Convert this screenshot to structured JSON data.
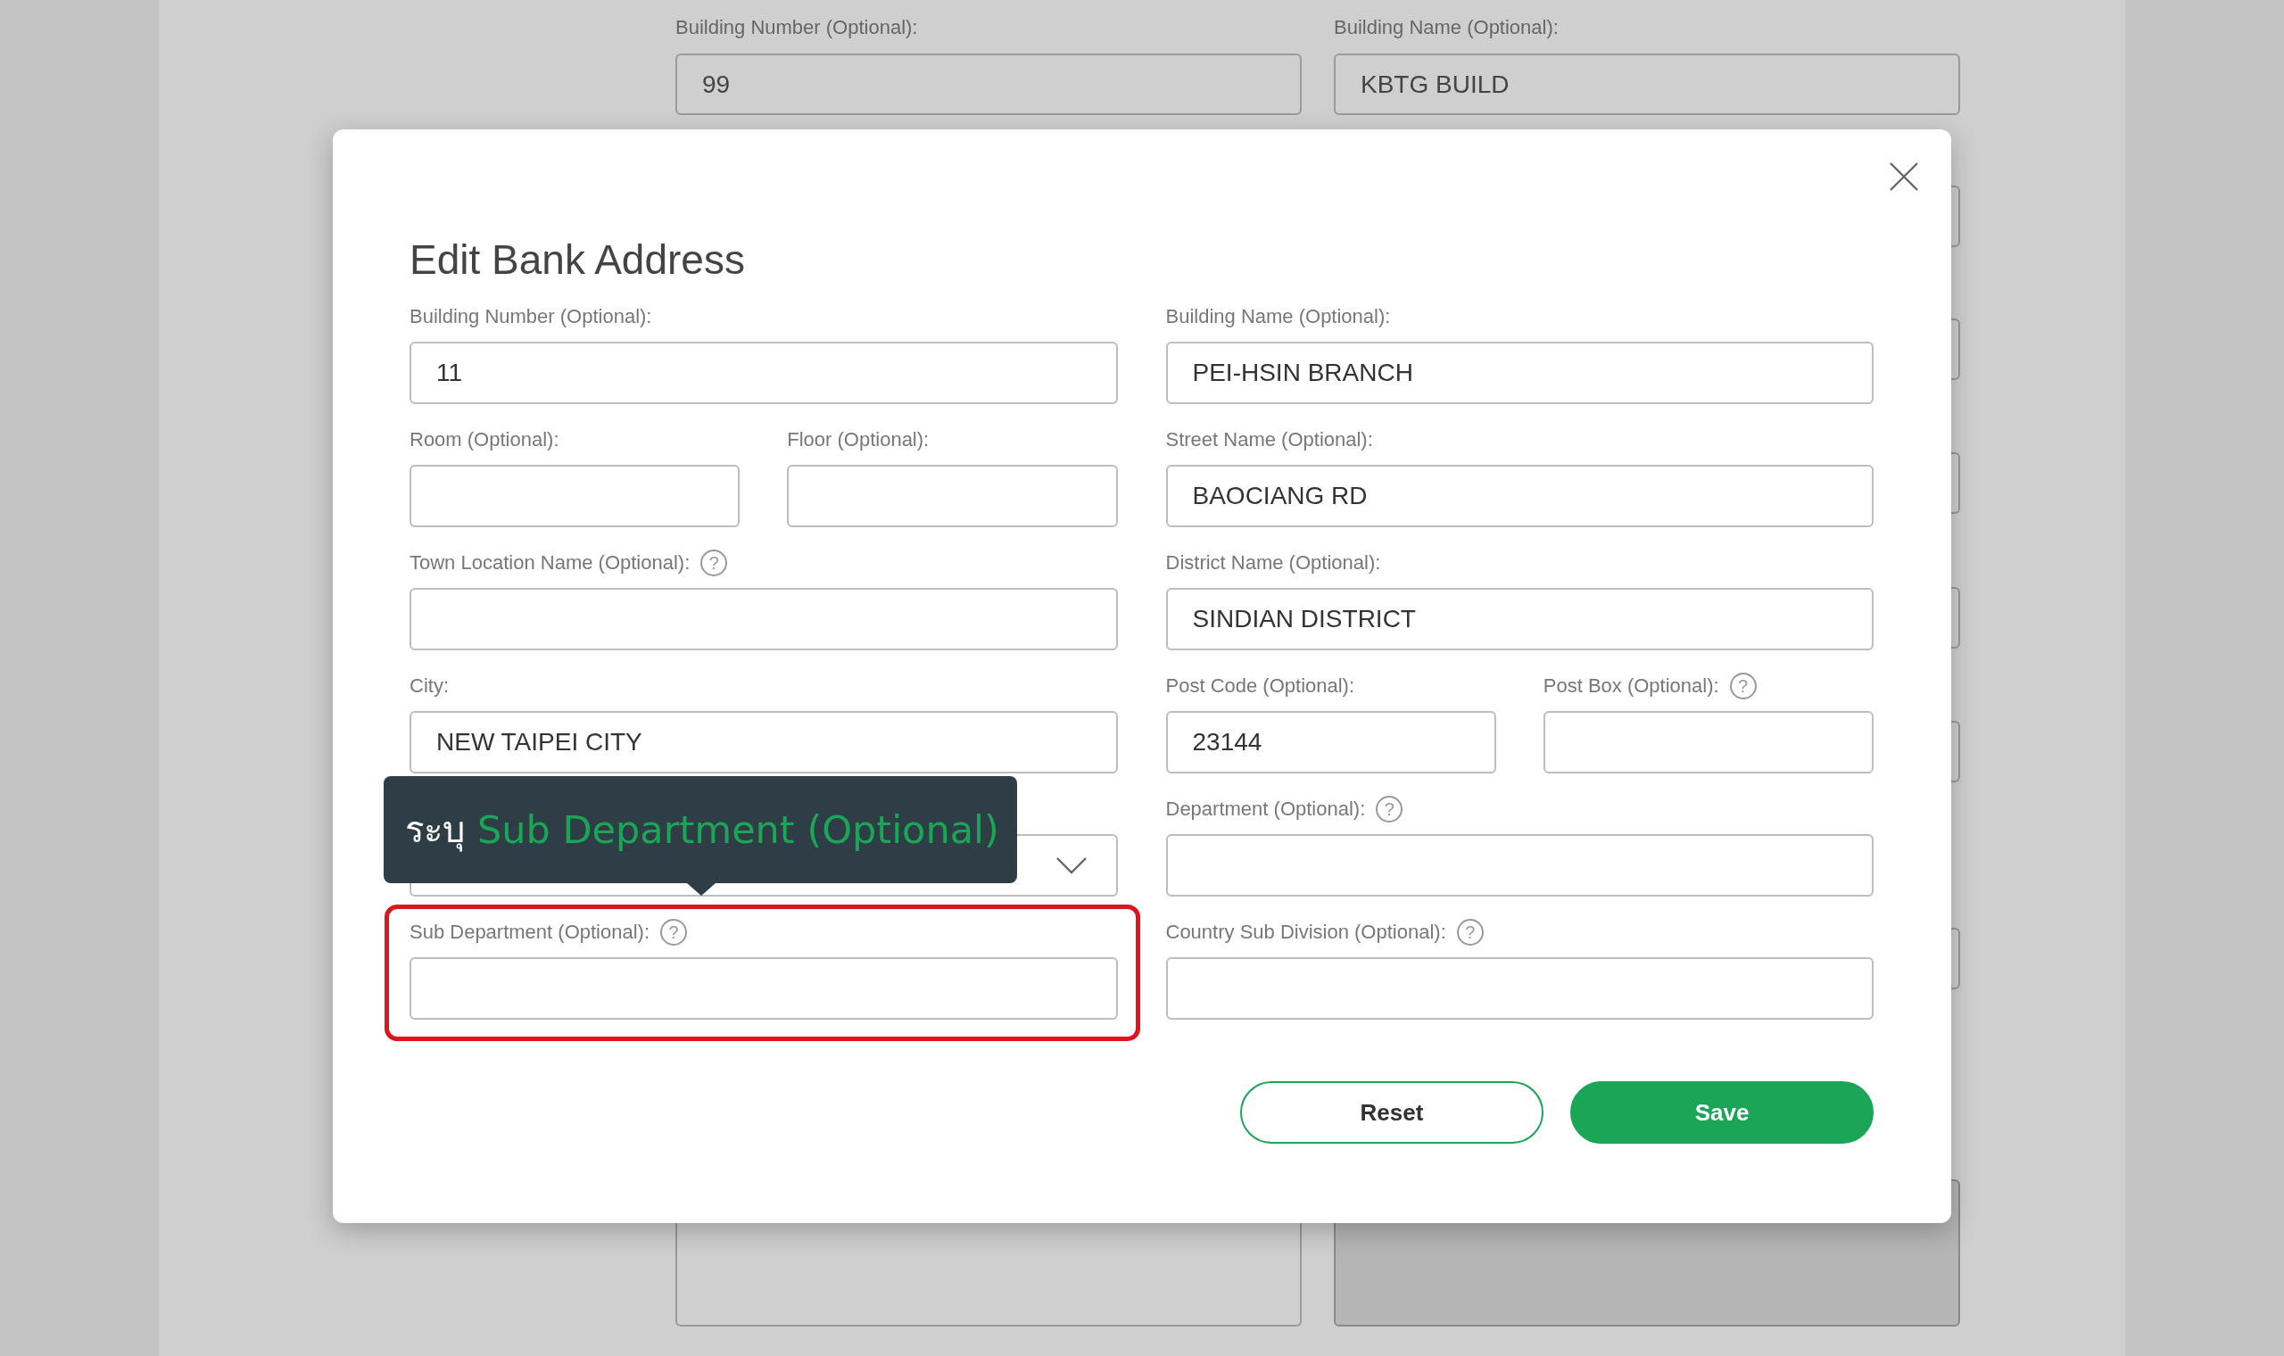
{
  "background_form": {
    "top_fields": [
      {
        "label": "Building Number (Optional):",
        "value": "99"
      },
      {
        "label": "Building Name (Optional):",
        "value": "KBTG BUILD"
      }
    ],
    "lower_fields": [
      {
        "disabled": false
      },
      {
        "disabled": true
      }
    ]
  },
  "dialog": {
    "title": "Edit Bank Address",
    "columns": [
      {
        "rows": [
          [
            {
              "kind": "text",
              "label": "Building Number (Optional):",
              "value": "11",
              "highlighted": false
            }
          ],
          [
            {
              "kind": "text",
              "label": "Room (Optional):",
              "highlighted": false
            },
            {
              "kind": "text",
              "label": "Floor (Optional):",
              "highlighted": false
            }
          ],
          [
            {
              "kind": "text",
              "label": "Town Location Name (Optional):",
              "help_icon": "?",
              "highlighted": false
            }
          ],
          [
            {
              "kind": "text",
              "label": "City:",
              "value": "NEW TAIPEI CITY",
              "highlighted": false
            }
          ],
          [
            {
              "kind": "select",
              "highlighted": false
            }
          ],
          [
            {
              "kind": "text",
              "label": "Sub Department (Optional):",
              "help_icon": "?",
              "highlighted": true
            }
          ]
        ]
      },
      {
        "rows": [
          [
            {
              "kind": "text",
              "label": "Building Name (Optional):",
              "value": "PEI-HSIN BRANCH",
              "highlighted": false
            }
          ],
          [
            {
              "kind": "text",
              "label": "Street Name (Optional):",
              "value": "BAOCIANG RD",
              "highlighted": false
            }
          ],
          [
            {
              "kind": "text",
              "label": "District Name (Optional):",
              "value": "SINDIAN DISTRICT",
              "highlighted": false
            }
          ],
          [
            {
              "kind": "text",
              "label": "Post Code (Optional):",
              "value": "23144",
              "highlighted": false
            },
            {
              "kind": "text",
              "label": "Post Box (Optional):",
              "help_icon": "?",
              "highlighted": false
            }
          ],
          [
            {
              "kind": "text",
              "label": "Department (Optional):",
              "help_icon": "?",
              "highlighted": false
            }
          ],
          [
            {
              "kind": "text",
              "label": "Country Sub Division (Optional):",
              "help_icon": "?",
              "highlighted": false
            }
          ]
        ]
      }
    ],
    "buttons": [
      {
        "kind": "secondary",
        "label": "Reset"
      },
      {
        "kind": "primary",
        "label": "Save"
      }
    ]
  },
  "tooltip": {
    "prefix": "ระบุ",
    "text": "Sub Department (Optional)"
  }
}
